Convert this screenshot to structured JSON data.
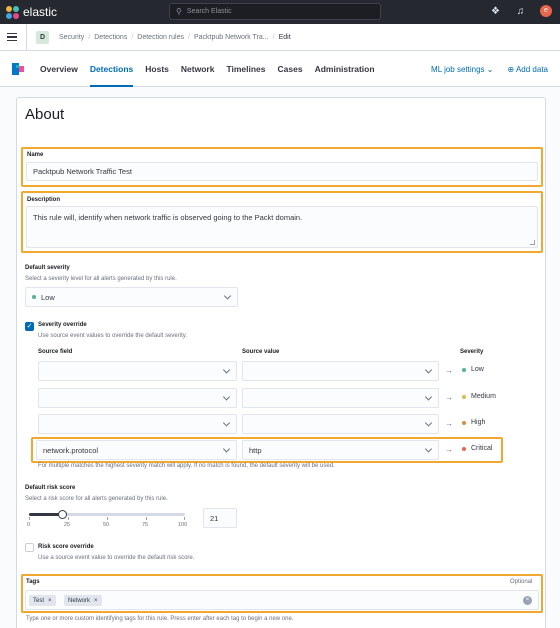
{
  "brand": {
    "name": "elastic"
  },
  "search": {
    "placeholder": "Search Elastic"
  },
  "breadcrumbs": {
    "space": "D",
    "items": [
      "Security",
      "Detections",
      "Detection rules",
      "Packtpub Network Tra...",
      "Edit"
    ]
  },
  "nav": {
    "tabs": [
      "Overview",
      "Detections",
      "Hosts",
      "Network",
      "Timelines",
      "Cases",
      "Administration"
    ],
    "active_tab": "Detections",
    "ml_job_settings": "ML job settings",
    "add_data": "Add data"
  },
  "form": {
    "title": "About",
    "name": {
      "label": "Name",
      "value": "Packtpub Network Traffic Test"
    },
    "description": {
      "label": "Description",
      "value": "This rule will, identify when network traffic is observed going to the Packt domain."
    },
    "default_severity": {
      "label": "Default severity",
      "help": "Select a severity level for all alerts generated by this rule.",
      "value": "Low"
    },
    "severity_override": {
      "label": "Severity override",
      "help": "Use source event values to override the default severity.",
      "checked": true,
      "col_source_field": "Source field",
      "col_source_value": "Source value",
      "col_severity": "Severity",
      "rows": [
        {
          "field": "",
          "value": "",
          "severity": "Low",
          "color": "#54b399"
        },
        {
          "field": "",
          "value": "",
          "severity": "Medium",
          "color": "#d6bf57"
        },
        {
          "field": "",
          "value": "",
          "severity": "High",
          "color": "#da8b45"
        },
        {
          "field": "network.protocol",
          "value": "http",
          "severity": "Critical",
          "color": "#e7664c"
        }
      ],
      "footnote": "For multiple matches the highest severity match will apply. If no match is found, the default severity will be used."
    },
    "risk_score": {
      "label": "Default risk score",
      "help": "Select a risk score for all alerts generated by this rule.",
      "value": "21",
      "ticks": [
        "0",
        "25",
        "50",
        "75",
        "100"
      ],
      "fill_fraction": 0.21
    },
    "risk_override": {
      "label": "Risk score override",
      "help": "Use a source event value to override the default risk score.",
      "checked": false
    },
    "tags": {
      "label": "Tags",
      "optional": "Optional",
      "items": [
        "Test",
        "Network"
      ],
      "help": "Type one or more custom identifying tags for this rule. Press enter after each tag to begin a new one."
    }
  },
  "colors": {
    "accent": "#006bb4",
    "highlight": "#f0a830",
    "topbar": "#25282f"
  }
}
